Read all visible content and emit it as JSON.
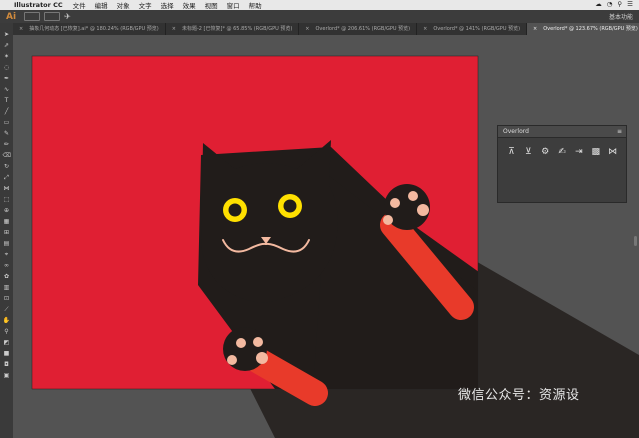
{
  "menubar": {
    "app": "Illustrator CC",
    "items": [
      "文件",
      "编辑",
      "对象",
      "文字",
      "选择",
      "效果",
      "视图",
      "窗口",
      "帮助"
    ]
  },
  "appbar": {
    "logo": "Ai",
    "workspace": "基本功能"
  },
  "tabs": [
    {
      "label": "抽象几何动态 [已恢复].ai* @ 180.24% (RGB/GPU 预览)",
      "active": false
    },
    {
      "label": "未标题-2 [已恢复]* @ 65.85% (RGB/GPU 预览)",
      "active": false
    },
    {
      "label": "Overlord* @ 206.61% (RGB/GPU 预览)",
      "active": false
    },
    {
      "label": "Overlord* @ 141% (RGB/GPU 预览)",
      "active": false
    },
    {
      "label": "Overlord* @ 123.67% (RGB/GPU 预览)",
      "active": true
    }
  ],
  "panel": {
    "title": "Overlord",
    "menu_icon": "≡"
  },
  "watermark": "微信公众号：资源设",
  "colors": {
    "artboard": "#e01f33",
    "cat": "#211c1a",
    "eyes": "#ffe000",
    "paw": "#f3b9a0",
    "arm": "#e83a2a"
  }
}
